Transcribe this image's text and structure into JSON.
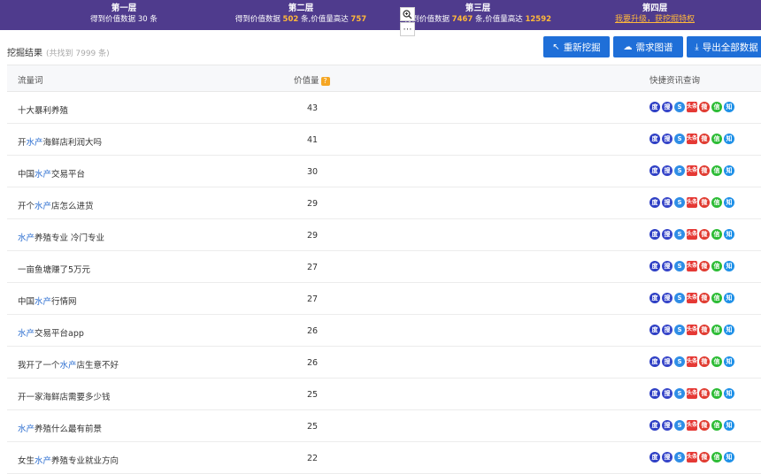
{
  "tiers": [
    {
      "title": "第一层",
      "line": "得到价值数据 30 条"
    },
    {
      "title": "第二层",
      "prefix": "得到价值数据 ",
      "count": "502",
      "mid": " 条,价值量高达 ",
      "max": "757"
    },
    {
      "title": "第三层",
      "prefix": "得到价值数据 ",
      "count": "7467",
      "mid": " 条,价值量高达 ",
      "max": "12592"
    },
    {
      "title": "第四层",
      "upgrade": "我要升级，获挖掘特权"
    }
  ],
  "float_buttons": {
    "zoom_icon": "zoom-in-icon",
    "more": "⋯"
  },
  "toolbar": {
    "title": "挖掘结果",
    "count": "(共找到 7999 条)",
    "redo_label": "重新挖掘",
    "chart_label": "需求图谱",
    "export_label": "导出全部数据"
  },
  "table": {
    "headers": {
      "keyword": "流量词",
      "value": "价值量",
      "query": "快捷资讯查询"
    },
    "query_icons": [
      "baidu-icon",
      "360-icon",
      "sogou-icon",
      "toutiao-icon",
      "weibo-icon",
      "wechat-icon",
      "zhihu-icon"
    ],
    "rows": [
      {
        "pre": "十大暴利养殖",
        "hl": "",
        "post": "",
        "value": "43"
      },
      {
        "pre": "开",
        "hl": "水产",
        "post": "海鲜店利润大吗",
        "value": "41"
      },
      {
        "pre": "中国",
        "hl": "水产",
        "post": "交易平台",
        "value": "30"
      },
      {
        "pre": "开个",
        "hl": "水产",
        "post": "店怎么进货",
        "value": "29"
      },
      {
        "pre": "",
        "hl": "水产",
        "post": "养殖专业 冷门专业",
        "value": "29"
      },
      {
        "pre": "一亩鱼塘赚了5万元",
        "hl": "",
        "post": "",
        "value": "27"
      },
      {
        "pre": "中国",
        "hl": "水产",
        "post": "行情网",
        "value": "27"
      },
      {
        "pre": "",
        "hl": "水产",
        "post": "交易平台app",
        "value": "26"
      },
      {
        "pre": "我开了一个",
        "hl": "水产",
        "post": "店生意不好",
        "value": "26"
      },
      {
        "pre": "开一家海鲜店需要多少钱",
        "hl": "",
        "post": "",
        "value": "25"
      },
      {
        "pre": "",
        "hl": "水产",
        "post": "养殖什么最有前景",
        "value": "25"
      },
      {
        "pre": "女生",
        "hl": "水产",
        "post": "养殖专业就业方向",
        "value": "22"
      }
    ]
  }
}
